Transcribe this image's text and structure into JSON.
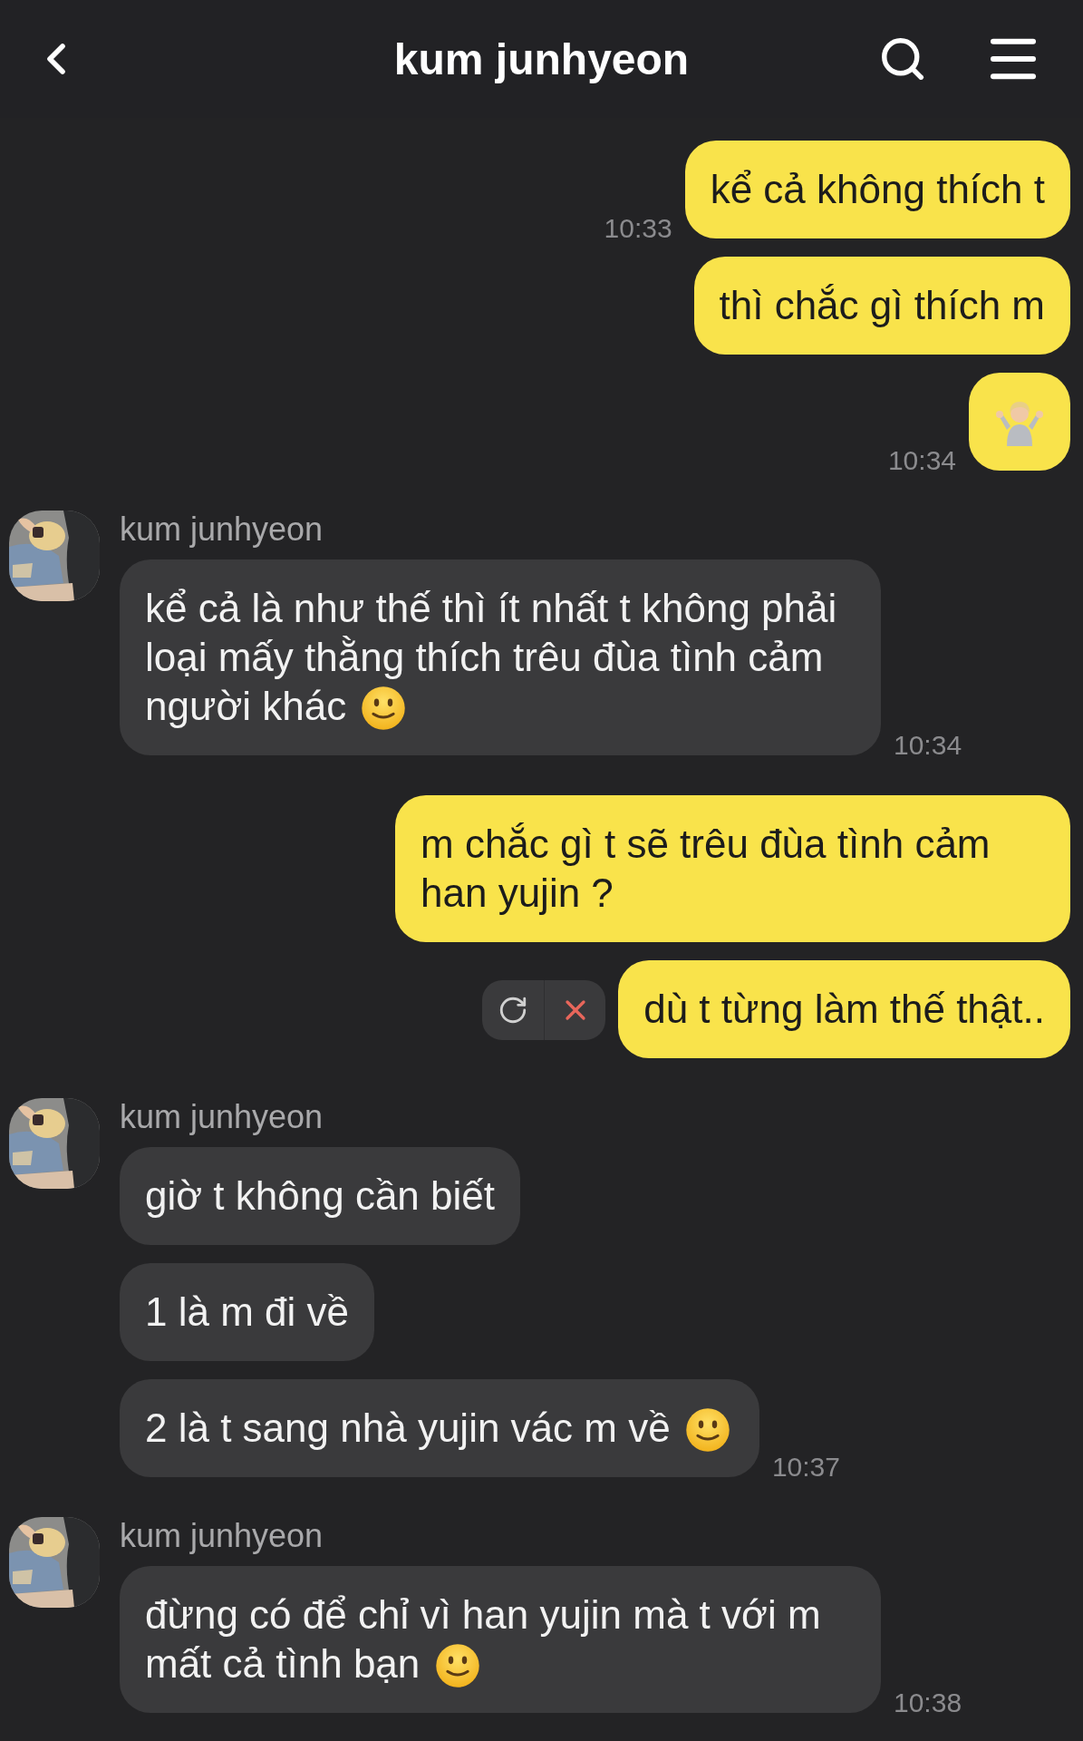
{
  "header": {
    "title": "kum junhyeon"
  },
  "groups": [
    {
      "kind": "outgoing",
      "bubbles": [
        {
          "parts": [
            {
              "kind": "text",
              "text": "kể cả không thích t"
            }
          ],
          "time": "10:33",
          "failed": false
        },
        {
          "parts": [
            {
              "kind": "text",
              "text": "thì chắc gì thích m"
            }
          ],
          "failed": false
        },
        {
          "parts": [
            {
              "kind": "shrug"
            }
          ],
          "time": "10:34",
          "failed": false
        }
      ]
    },
    {
      "kind": "incoming",
      "name": "kum junhyeon",
      "bubbles": [
        {
          "parts": [
            {
              "kind": "text",
              "text": "kể cả là như thế thì ít nhất t không phải loại mấy thằng thích trêu đùa tình cảm người khác"
            },
            {
              "kind": "smiley"
            }
          ],
          "time": "10:34",
          "failed": false
        }
      ]
    },
    {
      "kind": "outgoing",
      "bubbles": [
        {
          "parts": [
            {
              "kind": "text",
              "text": "m chắc gì t sẽ trêu đùa tình cảm han yujin ?"
            }
          ],
          "failed": false
        },
        {
          "parts": [
            {
              "kind": "text",
              "text": "dù t từng làm thế thật.."
            }
          ],
          "failed": true
        }
      ]
    },
    {
      "kind": "incoming",
      "name": "kum junhyeon",
      "bubbles": [
        {
          "parts": [
            {
              "kind": "text",
              "text": "giờ t không cần biết"
            }
          ],
          "failed": false
        },
        {
          "parts": [
            {
              "kind": "text",
              "text": "1 là m đi về"
            }
          ],
          "failed": false
        },
        {
          "parts": [
            {
              "kind": "text",
              "text": "2 là t sang nhà yujin vác m về"
            },
            {
              "kind": "smiley"
            }
          ],
          "time": "10:37",
          "failed": false
        }
      ]
    },
    {
      "kind": "incoming",
      "name": "kum junhyeon",
      "bubbles": [
        {
          "parts": [
            {
              "kind": "text",
              "text": "đừng có để chỉ vì han yujin mà t với m mất cả tình bạn"
            },
            {
              "kind": "smiley"
            }
          ],
          "time": "10:38",
          "failed": false
        }
      ]
    }
  ]
}
